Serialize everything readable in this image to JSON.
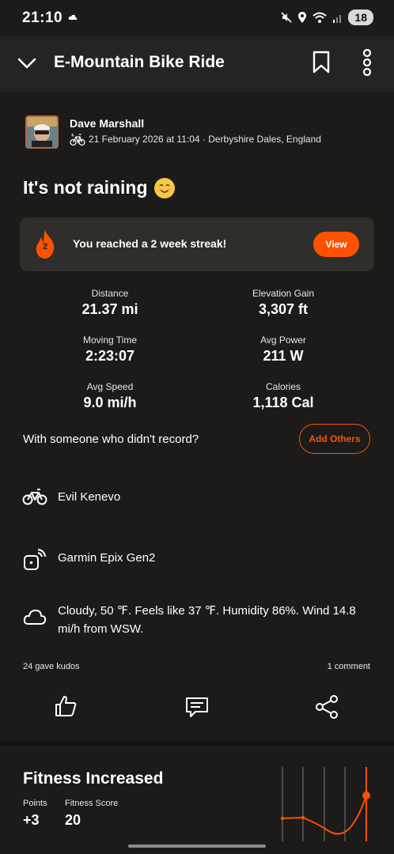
{
  "status_bar": {
    "time": "21:10",
    "battery": "18"
  },
  "header": {
    "title": "E-Mountain Bike Ride"
  },
  "author": {
    "name": "Dave Marshall",
    "meta": "21 February 2026 at 11:04 · Derbyshire Dales, England"
  },
  "activity": {
    "title": "It's not raining"
  },
  "streak": {
    "count": "2",
    "text": "You reached a 2 week streak!",
    "button": "View"
  },
  "stats": [
    {
      "label": "Distance",
      "value": "21.37 mi"
    },
    {
      "label": "Elevation Gain",
      "value": "3,307 ft"
    },
    {
      "label": "Moving Time",
      "value": "2:23:07"
    },
    {
      "label": "Avg Power",
      "value": "211 W"
    },
    {
      "label": "Avg Speed",
      "value": "9.0 mi/h"
    },
    {
      "label": "Calories",
      "value": "1,118 Cal"
    }
  ],
  "others": {
    "prompt": "With someone who didn't record?",
    "button": "Add Others"
  },
  "gear": {
    "bike": "Evil Kenevo",
    "device": "Garmin Epix Gen2"
  },
  "weather": {
    "text": "Cloudy, 50 ℉. Feels like 37 ℉. Humidity 86%. Wind 14.8 mi/h from WSW."
  },
  "social": {
    "kudos": "24 gave kudos",
    "comments": "1 comment"
  },
  "fitness": {
    "title": "Fitness Increased",
    "points_label": "Points",
    "points_value": "+3",
    "score_label": "Fitness Score",
    "score_value": "20"
  },
  "colors": {
    "accent": "#fc5200",
    "background": "#1c1b19",
    "card": "#2f2e2b"
  },
  "icons": [
    "chevron-down-icon",
    "bookmark-icon",
    "more-vertical-icon",
    "ebike-icon",
    "flame-icon",
    "bike-icon",
    "watch-icon",
    "cloud-icon",
    "thumbs-up-icon",
    "comment-icon",
    "share-icon"
  ]
}
